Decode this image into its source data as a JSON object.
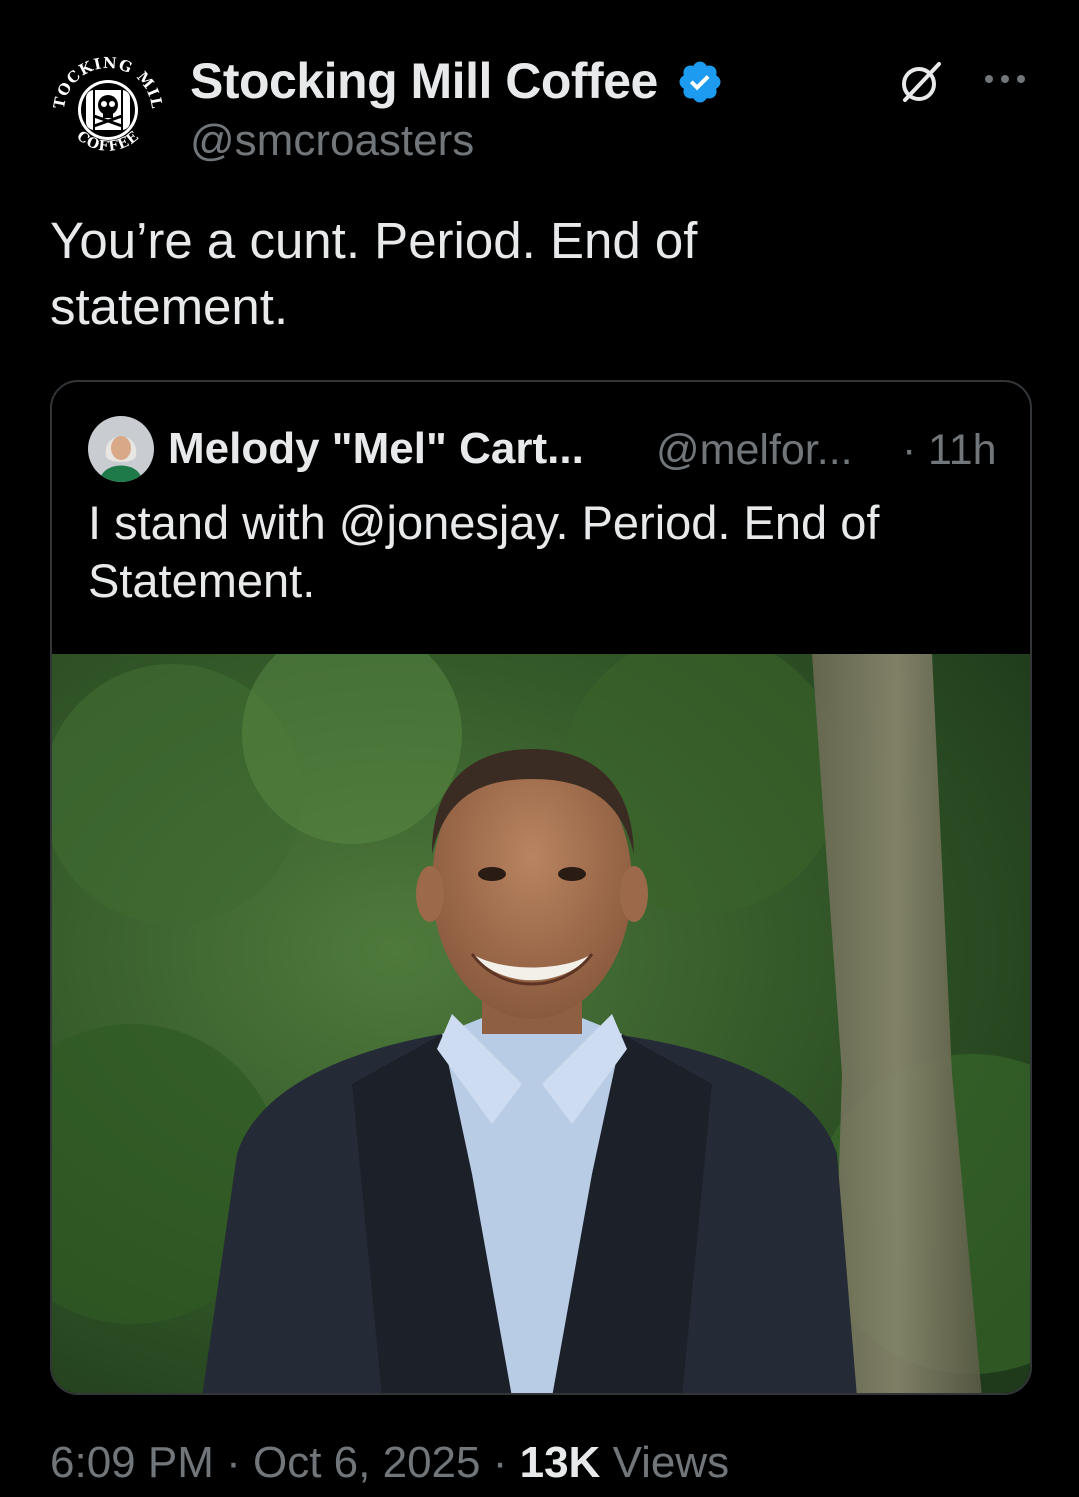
{
  "tweet": {
    "author": {
      "name": "Stocking Mill Coffee",
      "handle": "@smcroasters",
      "avatar_logo_text": [
        "STOCKING MILL",
        "COFFEE"
      ],
      "verified_icon": "verified-badge-icon",
      "verified_color": "#1d9bf0"
    },
    "text_line1": "You’re a cunt. Period. End of",
    "text_line2": "statement.",
    "actions": {
      "grok_icon": "grok-icon",
      "more_icon": "more-options-icon"
    },
    "quote": {
      "author_name": "Melody \"Mel\" Cart...",
      "author_handle": "@melfor...",
      "separator": "·",
      "time": "11h",
      "text_line1": "I stand with @jonesjay. Period. End of",
      "text_line2": "Statement.",
      "photo_icon": "portrait-photo"
    },
    "footer": {
      "time": "6:09 PM",
      "separator": "·",
      "date": "Oct 6, 2025",
      "views_count": "13K",
      "views_label": "Views"
    }
  },
  "colors": {
    "background": "#000000",
    "text_primary": "#e7e9ea",
    "text_secondary": "#71767b",
    "border": "#333639",
    "accent": "#1d9bf0"
  }
}
